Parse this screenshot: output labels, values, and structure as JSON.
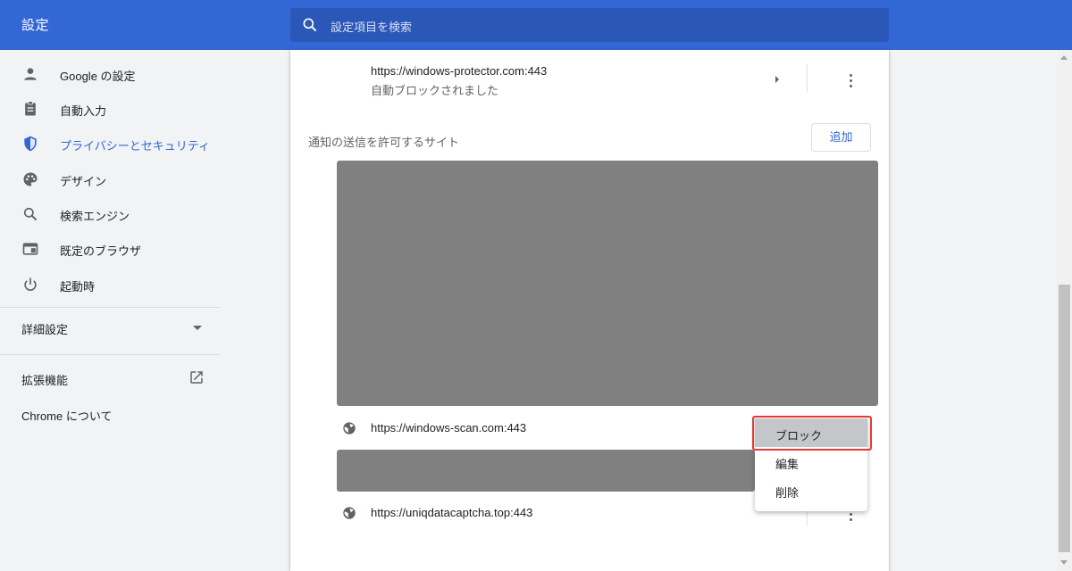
{
  "header": {
    "title": "設定",
    "search_placeholder": "設定項目を検索"
  },
  "sidebar": {
    "items": [
      {
        "label": "Google の設定",
        "icon": "person-icon",
        "active": false
      },
      {
        "label": "自動入力",
        "icon": "clipboard-icon",
        "active": false
      },
      {
        "label": "プライバシーとセキュリティ",
        "icon": "shield-icon",
        "active": true
      },
      {
        "label": "デザイン",
        "icon": "palette-icon",
        "active": false
      },
      {
        "label": "検索エンジン",
        "icon": "search-icon",
        "active": false
      },
      {
        "label": "既定のブラウザ",
        "icon": "browser-icon",
        "active": false
      },
      {
        "label": "起動時",
        "icon": "power-icon",
        "active": false
      }
    ],
    "advanced_label": "詳細設定",
    "extensions_label": "拡張機能",
    "about_label": "Chrome について"
  },
  "main": {
    "blocked_site": {
      "url": "https://windows-protector.com:443",
      "status": "自動ブロックされました"
    },
    "allowed_section_title": "通知の送信を許可するサイト",
    "add_button_label": "追加",
    "allowed_sites": [
      {
        "url": "https://windows-scan.com:443"
      },
      {
        "url": "https://uniqdatacaptcha.top:443"
      }
    ]
  },
  "context_menu": {
    "items": [
      "ブロック",
      "編集",
      "削除"
    ]
  },
  "colors": {
    "header_bg": "#3367d6",
    "accent": "#3367d6",
    "highlight_border": "#e53935",
    "redacted_block": "#808080"
  }
}
